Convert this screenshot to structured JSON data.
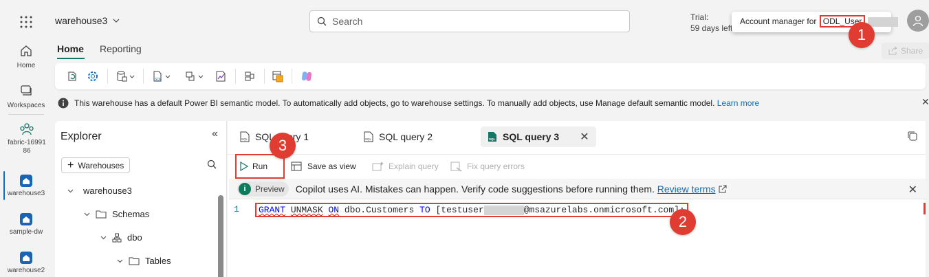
{
  "topbar": {
    "workspace_title": "warehouse3",
    "search_placeholder": "Search",
    "trial_line1": "Trial:",
    "trial_line2": "59 days left",
    "tooltip_prefix": "Account manager for ",
    "tooltip_user": "ODL_User",
    "share_label": "Share"
  },
  "rail": {
    "items": [
      {
        "label": "Home",
        "icon": "home-icon"
      },
      {
        "label": "Workspaces",
        "icon": "workspaces-icon"
      },
      {
        "label": "fabric-1699186",
        "icon": "fabric-workspace-icon"
      },
      {
        "label": "warehouse3",
        "icon": "warehouse-icon"
      },
      {
        "label": "sample-dw",
        "icon": "warehouse-icon"
      },
      {
        "label": "warehouse2",
        "icon": "warehouse-icon"
      }
    ]
  },
  "ribbon": {
    "tabs": [
      "Home",
      "Reporting"
    ],
    "active_tab": "Home"
  },
  "infobar": {
    "message": "This warehouse has a default Power BI semantic model. To automatically add objects, go to warehouse settings. To manually add objects, use Manage default semantic model.",
    "link": "Learn more"
  },
  "explorer": {
    "title": "Explorer",
    "add_button": "Warehouses",
    "tree": [
      {
        "label": "warehouse3",
        "level": 0
      },
      {
        "label": "Schemas",
        "level": 1
      },
      {
        "label": "dbo",
        "level": 2
      },
      {
        "label": "Tables",
        "level": 3
      }
    ]
  },
  "editor": {
    "tabs": [
      "SQL query 1",
      "SQL query 2",
      "SQL query 3"
    ],
    "active_tab": "SQL query 3",
    "toolbar": {
      "run": "Run",
      "save_as_view": "Save as view",
      "explain_query": "Explain query",
      "fix_query_errors": "Fix query errors"
    },
    "copilot": {
      "badge": "Preview",
      "bold": "Copilot uses AI.",
      "message": " Mistakes can happen. Verify code suggestions before running them. ",
      "link": "Review terms"
    },
    "code": {
      "line_number": "1",
      "kw_grant": "GRANT",
      "kw_unmask": "UNMASK",
      "kw_on": "ON",
      "object": " dbo.Customers ",
      "kw_to": "TO",
      "principal_prefix": " [testuser",
      "principal_suffix": "@msazurelabs.onmicrosoft.com];"
    }
  },
  "callouts": [
    "1",
    "2",
    "3"
  ],
  "colors": {
    "accent": "#117865",
    "callout": "#e03c31",
    "link": "#0f6cbd",
    "sql_keyword": "#0000ff"
  }
}
